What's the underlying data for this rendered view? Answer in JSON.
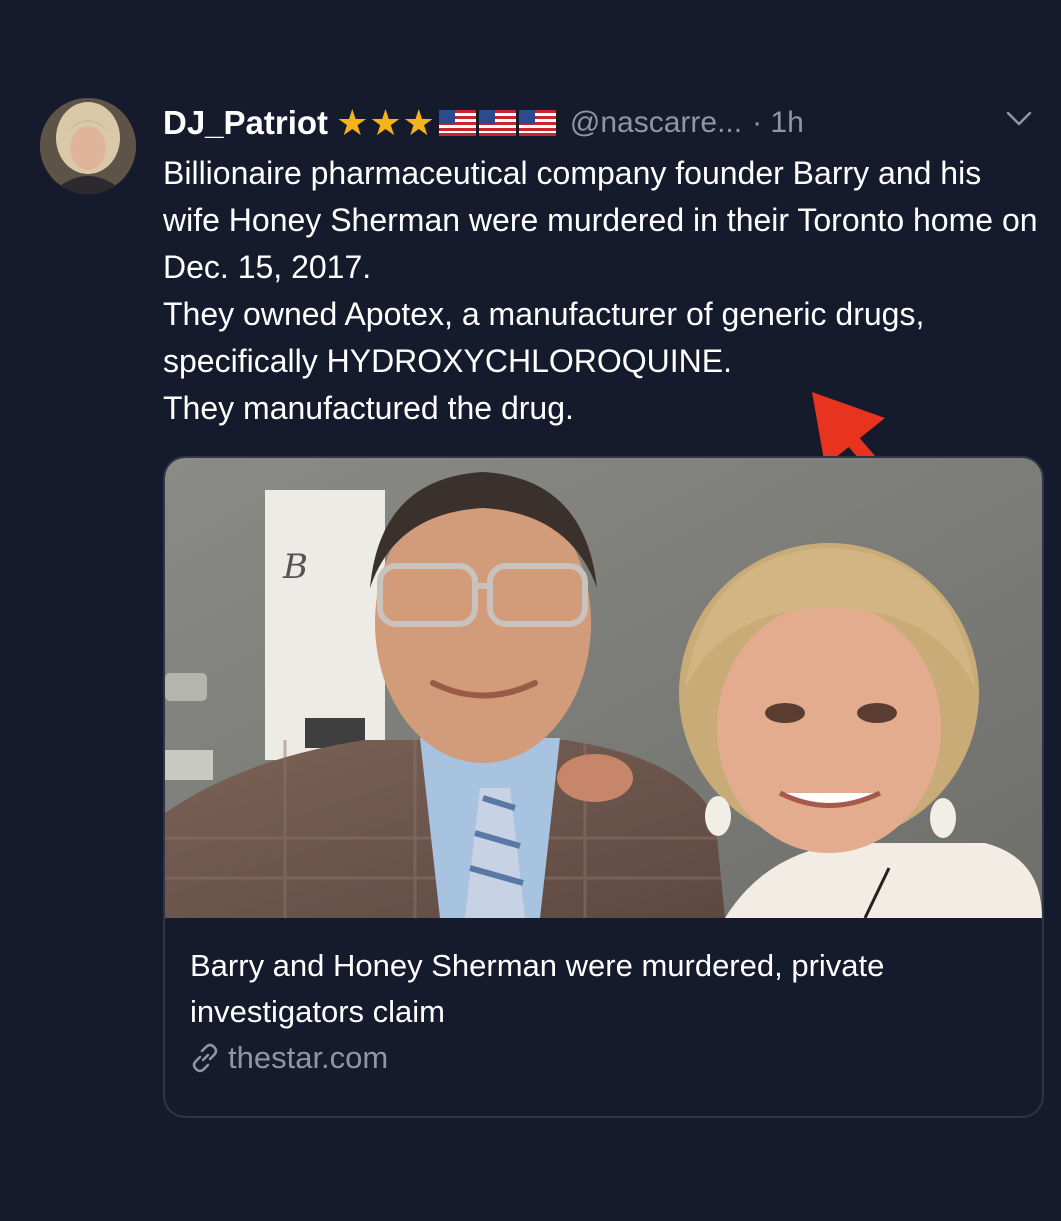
{
  "tweet": {
    "display_name": "DJ_Patriot",
    "badges": {
      "stars": [
        "★",
        "★",
        "★"
      ],
      "flags": [
        "us-flag-icon",
        "us-flag-icon",
        "us-flag-icon"
      ]
    },
    "handle": "@nascarre...",
    "time": "· 1h",
    "body_lines": [
      "Billionaire pharmaceutical company founder Barry and his wife Honey Sherman were murdered in their Toronto home on Dec. 15, 2017.",
      "They owned Apotex, a manufacturer of generic drugs, specifically HYDROXYCHLOROQUINE.",
      "They manufactured the drug."
    ]
  },
  "card": {
    "title": "Barry and Honey Sherman were murdered, private investigators claim",
    "domain": "thestar.com"
  },
  "colors": {
    "background": "#151b2c",
    "muted_text": "#8d96a6",
    "star": "#f6b21a",
    "annotation_arrow": "#e8331f"
  }
}
